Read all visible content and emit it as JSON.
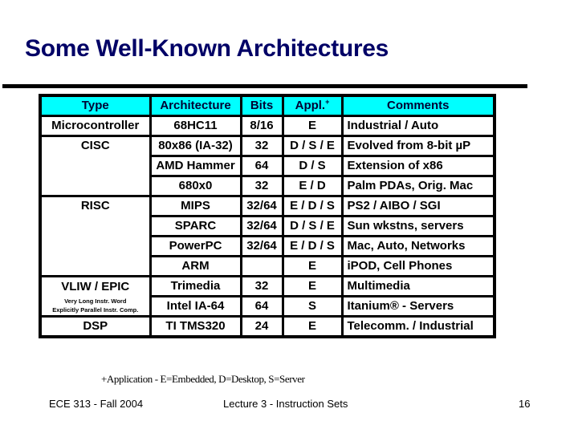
{
  "slide": {
    "title": "Some Well-Known Architectures",
    "table": {
      "headers": {
        "type": "Type",
        "architecture": "Architecture",
        "bits": "Bits",
        "appl": "Appl.",
        "appl_marker": "+",
        "comments": "Comments"
      },
      "groups": {
        "microcontroller": "Microcontroller",
        "cisc": "CISC",
        "risc": "RISC",
        "vliw": "VLIW / EPIC",
        "vliw_sub1": "Very Long Instr. Word",
        "vliw_sub2": "Explicitly Parallel Instr. Comp.",
        "dsp": "DSP"
      },
      "rows": [
        {
          "architecture": "68HC11",
          "bits": "8/16",
          "appl": "E",
          "comments": "Industrial / Auto"
        },
        {
          "architecture": "80x86 (IA-32)",
          "bits": "32",
          "appl": "D / S / E",
          "comments": "Evolved from 8-bit µP"
        },
        {
          "architecture": "AMD Hammer",
          "bits": "64",
          "appl": "D / S",
          "comments": "Extension of x86"
        },
        {
          "architecture": "680x0",
          "bits": "32",
          "appl": "E / D",
          "comments": "Palm PDAs, Orig. Mac"
        },
        {
          "architecture": "MIPS",
          "bits": "32/64",
          "appl": "E / D / S",
          "comments": "PS2 / AIBO / SGI"
        },
        {
          "architecture": "SPARC",
          "bits": "32/64",
          "appl": "D / S / E",
          "comments": "Sun wkstns, servers"
        },
        {
          "architecture": "PowerPC",
          "bits": "32/64",
          "appl": "E / D / S",
          "comments": "Mac, Auto, Networks"
        },
        {
          "architecture": "ARM",
          "bits": "",
          "appl": "E",
          "comments": "iPOD, Cell Phones"
        },
        {
          "architecture": "Trimedia",
          "bits": "32",
          "appl": "E",
          "comments": "Multimedia"
        },
        {
          "architecture": "Intel IA-64",
          "bits": "64",
          "appl": "S",
          "comments": "Itanium® - Servers"
        },
        {
          "architecture": "TI TMS320",
          "bits": "24",
          "appl": "E",
          "comments": "Telecomm. / Industrial"
        }
      ]
    },
    "footnote": "+Application - E=Embedded, D=Desktop, S=Server",
    "footer": {
      "course": "ECE 313 - Fall 2004",
      "lecture": "Lecture 3 - Instruction Sets",
      "page": "16"
    }
  },
  "colors": {
    "title": "#000066",
    "header_bg": "#00ffff"
  }
}
